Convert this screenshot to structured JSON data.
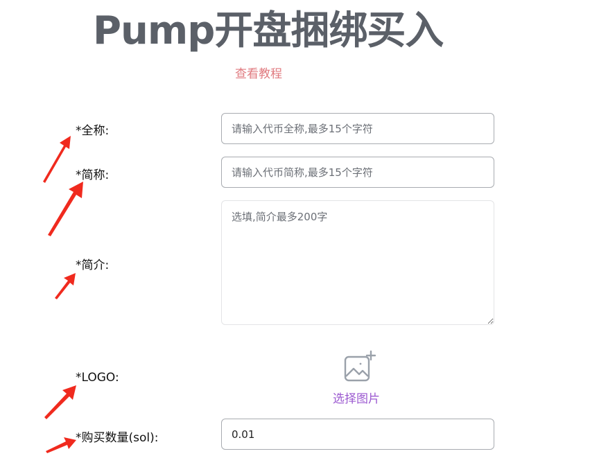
{
  "header": {
    "title": "Pump开盘捆绑买入",
    "tutorial_link": "查看教程"
  },
  "form": {
    "full_name": {
      "label": "*全称:",
      "placeholder": "请输入代币全称,最多15个字符",
      "value": ""
    },
    "short_name": {
      "label": "*简称:",
      "placeholder": "请输入代币简称,最多15个字符",
      "value": ""
    },
    "description": {
      "label": "*简介:",
      "placeholder": "选填,简介最多200字",
      "value": ""
    },
    "logo": {
      "label": "*LOGO:",
      "button_label": "选择图片",
      "icon": "image-add-icon"
    },
    "buy_amount": {
      "label": "*购买数量(sol):",
      "value": "0.01"
    }
  },
  "annotations": {
    "arrow_color": "#f02a1e"
  },
  "colors": {
    "title": "#5b6068",
    "tutorial_link": "#e07a7f",
    "upload_label": "#9b59d0"
  }
}
